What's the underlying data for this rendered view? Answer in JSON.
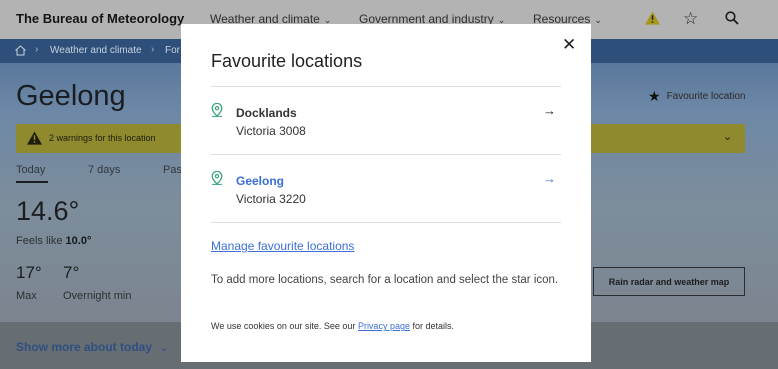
{
  "nav": {
    "brand": "The Bureau of Meteorology",
    "items": [
      "Weather and climate",
      "Government and industry",
      "Resources"
    ]
  },
  "breadcrumb": {
    "items": [
      "Weather and climate",
      "For"
    ]
  },
  "location": {
    "city": "Geelong",
    "favourite_label": "Favourite location",
    "warning_text": "2 warnings for this location",
    "tabs": [
      "Today",
      "7 days",
      "Pas"
    ],
    "temperature": "14.6°",
    "feels_like_label": "Feels like",
    "feels_like_value": "10.0°",
    "max_value": "17°",
    "max_label": "Max",
    "min_value": "7°",
    "min_label": "Overnight min",
    "radar_button": "Rain radar and weather map",
    "show_more": "Show more about today"
  },
  "modal": {
    "title": "Favourite locations",
    "locations": [
      {
        "name": "Docklands",
        "state": "Victoria 3008"
      },
      {
        "name": "Geelong",
        "state": "Victoria 3220"
      }
    ],
    "manage_link": "Manage favourite locations",
    "help_text": "To add more locations, search for a location and select the star icon.",
    "cookie_prefix": "We use cookies on our site. See our",
    "cookie_link": "Privacy page",
    "cookie_suffix": "for details."
  },
  "colors": {
    "accent": "#3b6fd6",
    "pin": "#3aa57a",
    "warning": "#f2e33a"
  }
}
